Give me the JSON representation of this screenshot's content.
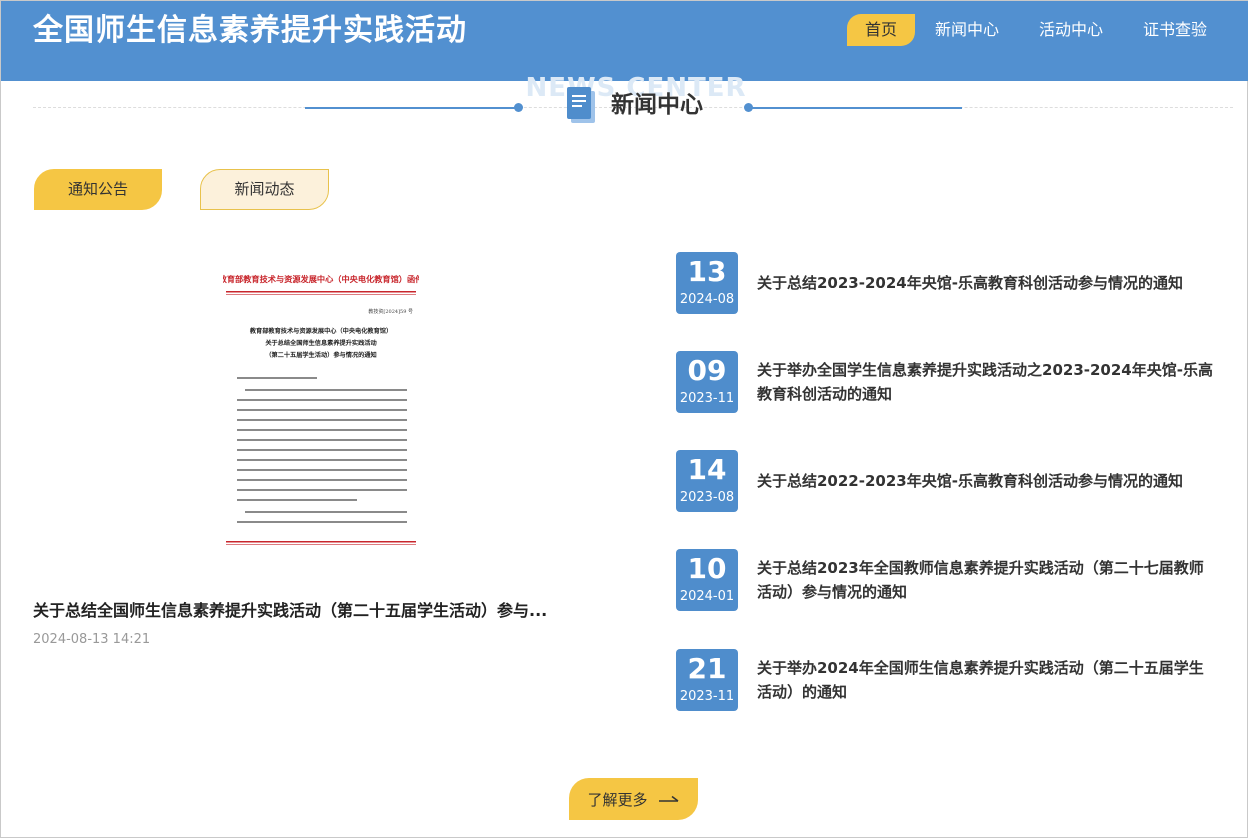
{
  "header": {
    "site_title": "全国师生信息素养提升实践活动",
    "nav": [
      {
        "label": "首页",
        "active": true
      },
      {
        "label": "新闻中心",
        "active": false
      },
      {
        "label": "活动中心",
        "active": false
      },
      {
        "label": "证书查验",
        "active": false
      }
    ]
  },
  "section": {
    "title": "新闻中心",
    "ghost_title": "NEWS CENTER"
  },
  "tabs": [
    {
      "label": "通知公告"
    },
    {
      "label": "新闻动态"
    }
  ],
  "featured": {
    "title": "关于总结全国师生信息素养提升实践活动（第二十五届学生活动）参与...",
    "datetime": "2024-08-13 14:21",
    "doc": {
      "letterhead": "教育部教育技术与资源发展中心（中央电化教育馆）函件",
      "number": "教技资[2024]59 号",
      "heading1": "教育部教育技术与资源发展中心（中央电化教育馆）",
      "heading2": "关于总结全国师生信息素养提升实践活动",
      "heading3": "（第二十五届学生活动）参与情况的通知"
    }
  },
  "news": [
    {
      "day": "13",
      "ym": "2024-08",
      "title": "关于总结2023-2024年央馆-乐高教育科创活动参与情况的通知"
    },
    {
      "day": "09",
      "ym": "2023-11",
      "title": "关于举办全国学生信息素养提升实践活动之2023-2024年央馆-乐高教育科创活动的通知"
    },
    {
      "day": "14",
      "ym": "2023-08",
      "title": "关于总结2022-2023年央馆-乐高教育科创活动参与情况的通知"
    },
    {
      "day": "10",
      "ym": "2024-01",
      "title": "关于总结2023年全国教师信息素养提升实践活动（第二十七届教师活动）参与情况的通知"
    },
    {
      "day": "21",
      "ym": "2023-11",
      "title": "关于举办2024年全国师生信息素养提升实践活动（第二十五届学生活动）的通知"
    }
  ],
  "more_button": {
    "label": "了解更多"
  },
  "colors": {
    "header_bg": "#5290d0",
    "accent_yellow": "#f5c644",
    "date_box": "#4f8dcc"
  }
}
